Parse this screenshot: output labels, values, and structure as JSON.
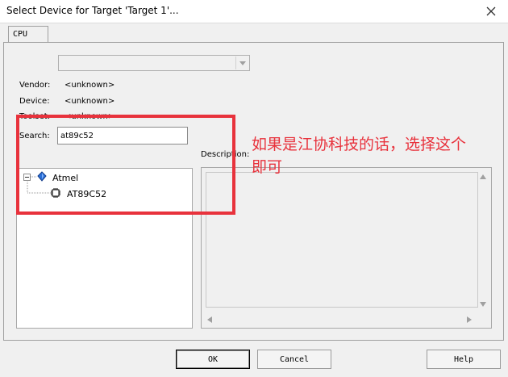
{
  "window": {
    "title": "Select Device for Target 'Target 1'...",
    "close_icon": "close-icon"
  },
  "tabs": [
    {
      "label": "CPU"
    }
  ],
  "combo": {
    "selected": ""
  },
  "fields": {
    "vendor_label": "Vendor:",
    "vendor_value": "<unknown>",
    "device_label": "Device:",
    "device_value": "<unknown>",
    "toolset_label": "Toolset:",
    "toolset_value": "<unknown>",
    "search_label": "Search:",
    "search_value": "at89c52",
    "description_label": "Description:"
  },
  "tree": {
    "vendor_node": {
      "label": "Atmel",
      "icon": "vendor-diamond-icon"
    },
    "device_node": {
      "label": "AT89C52",
      "icon": "chip-icon"
    }
  },
  "buttons": {
    "ok": "OK",
    "cancel": "Cancel",
    "help": "Help"
  },
  "annotation": {
    "line1": "如果是江协科技的话，选择这个",
    "line2": "即可",
    "color": "#e8323c"
  }
}
